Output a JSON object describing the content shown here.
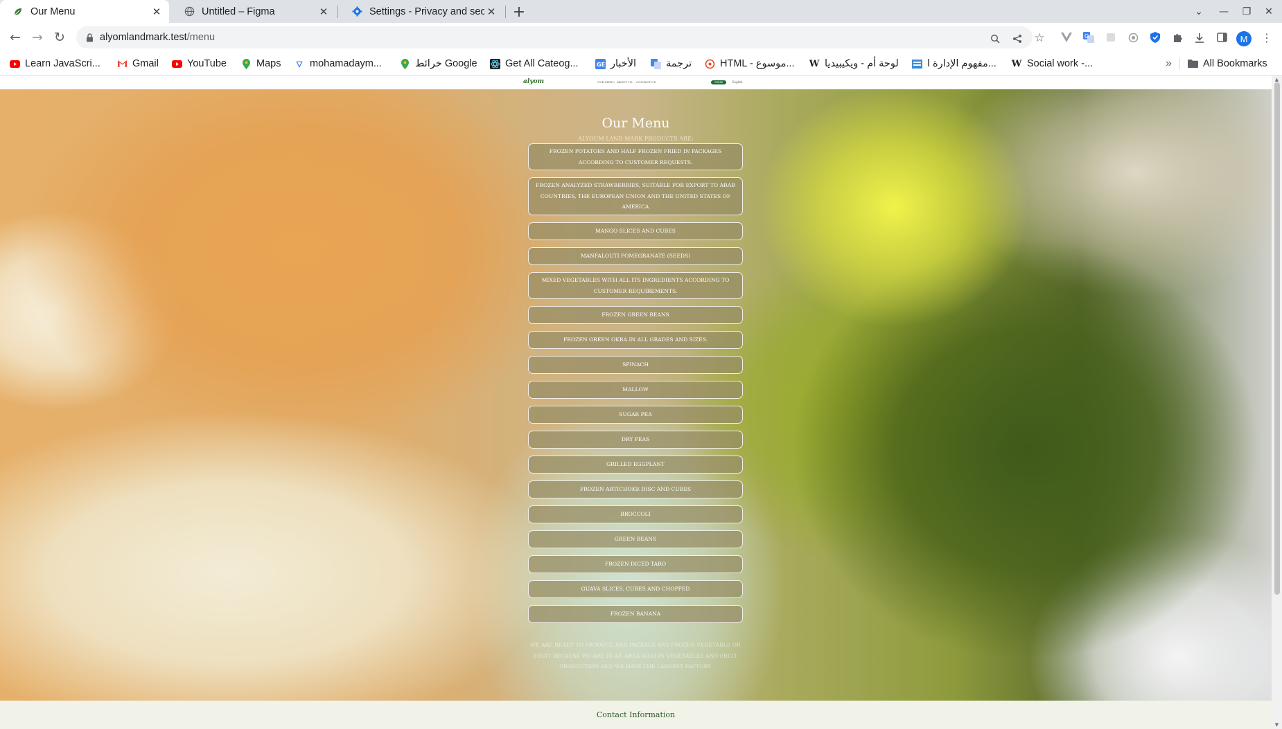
{
  "tabs": [
    {
      "title": "Our Menu",
      "icon": "leaf-icon",
      "active": true
    },
    {
      "title": "Untitled – Figma",
      "icon": "globe-icon",
      "active": false
    },
    {
      "title": "Settings - Privacy and sec",
      "icon": "gear-icon",
      "active": false
    }
  ],
  "address": {
    "host": "alyomlandmark.test",
    "path": "/menu"
  },
  "bookmarks": [
    {
      "label": "Learn JavaScri...",
      "icon": "youtube-icon"
    },
    {
      "label": "Gmail",
      "icon": "gmail-icon"
    },
    {
      "label": "YouTube",
      "icon": "youtube-icon"
    },
    {
      "label": "Maps",
      "icon": "maps-pin-icon"
    },
    {
      "label": "mohamadaym...",
      "icon": "bookmark-site-icon"
    },
    {
      "label": "خرائط Google",
      "icon": "maps-pin-icon"
    },
    {
      "label": "Get All Cateog...",
      "icon": "react-icon"
    },
    {
      "label": "الأخبار",
      "icon": "news-icon"
    },
    {
      "label": "ترجمة",
      "icon": "translate-icon"
    },
    {
      "label": "HTML - موسوع...",
      "icon": "html-site-icon"
    },
    {
      "label": "لوحة أم - ويكيبيديا",
      "icon": "wikipedia-icon"
    },
    {
      "label": "مفهوم الإدارة ا...",
      "icon": "bookmark-site-icon"
    },
    {
      "label": "Social work -...",
      "icon": "wikipedia-icon"
    }
  ],
  "bookmarks_more": "»",
  "all_bookmarks": "All Bookmarks",
  "avatar_letter": "M",
  "site": {
    "logo": "alyom",
    "nav": [
      "OUR MENU",
      "ABOUT US",
      "CONTACT US"
    ],
    "nav_button": "ORDER",
    "language": "English"
  },
  "menu": {
    "title": "Our Menu",
    "subtitle": "ALYOUM LAND MARK PRODUCTS ARE:",
    "items": [
      "FROZEN POTATOES AND HALF FROZEN FRIED IN PACKAGES ACCORDING TO CUSTOMER REQUESTS.",
      "FROZEN ANALYZED STRAWBERRIES, SUITABLE FOR EXPORT TO ARAB COUNTRIES, THE EUROPEAN UNION AND THE UNITED STATES OF AMERICA",
      "MANGO SLICES AND CUBES",
      "MANFALOUTI POMEGRANATE (SEEDS)",
      "MIXED VEGETABLES WITH ALL ITS INGREDIENTS ACCORDING TO CUSTOMER REQUIREMENTS.",
      "FROZEN GREEN BEANS",
      "FROZEN GREEN OKRA IN ALL GRADES AND SIZES.",
      "SPINACH",
      "MALLOW",
      "SUGAR PEA",
      "DRY PEAS",
      "GRILLED EGGPLANT",
      "FROZEN ARTICHOKE DISC AND CUBES",
      "BROCCOLI",
      "GREEN BEANS",
      "FROZEN DICED TARO",
      "GUAVA SLICES, CUBES AND CHOPPED",
      "FROZEN BANANA"
    ],
    "footer_note": "WE ARE READY TO PRODUCE AND PACKAGE ANY FROZEN VEGETABLE OR FRUIT BECAUSE WE ARE IN AN AREA RICH IN VEGETABLES AND FRUIT PRODUCTION AND WE HAVE THE LARGEST FACTORY"
  },
  "contact": {
    "label": "Contact Information"
  }
}
